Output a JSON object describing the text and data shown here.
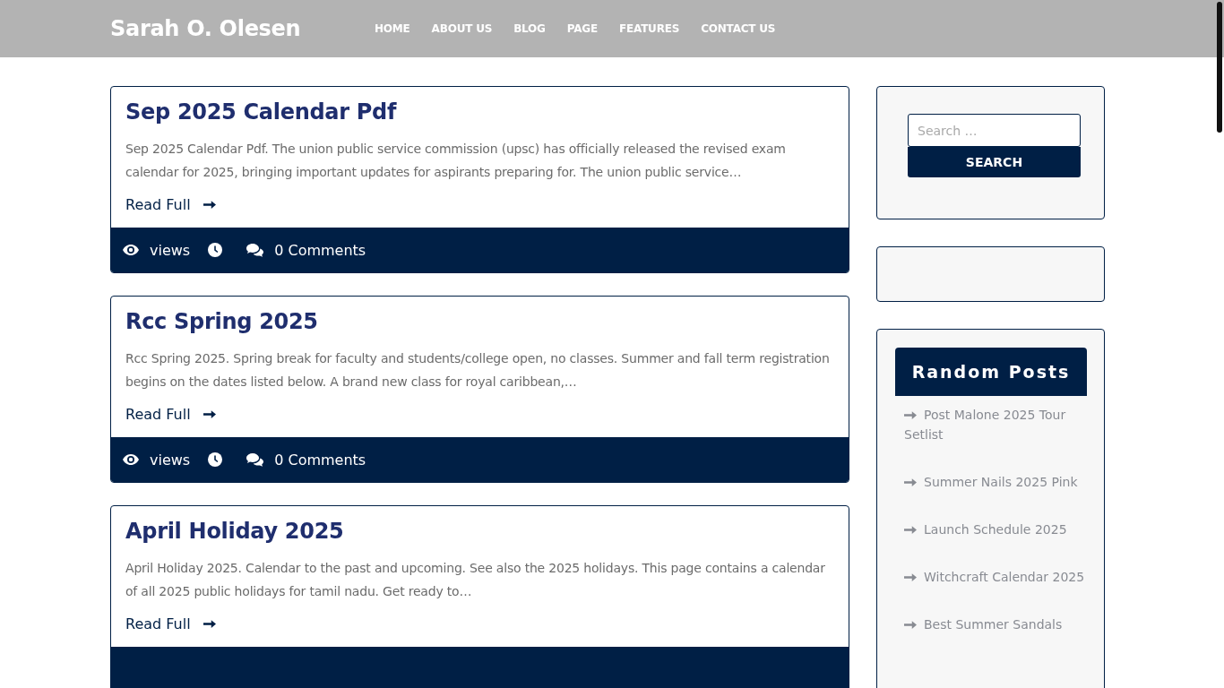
{
  "header": {
    "site_title": "Sarah O. Olesen",
    "nav": [
      {
        "label": "HOME"
      },
      {
        "label": "ABOUT US"
      },
      {
        "label": "BLOG"
      },
      {
        "label": "PAGE"
      },
      {
        "label": "FEATURES"
      },
      {
        "label": "CONTACT US"
      }
    ]
  },
  "posts": [
    {
      "title": "Sep 2025 Calendar Pdf",
      "excerpt": "Sep 2025 Calendar Pdf. The union public service commission (upsc) has officially released the revised exam calendar for 2025, bringing important updates for aspirants preparing for. The union public service…",
      "read_more": "Read Full",
      "meta": {
        "views": "views",
        "comments": "0 Comments"
      }
    },
    {
      "title": "Rcc Spring 2025",
      "excerpt": "Rcc Spring 2025. Spring break for faculty and students/college open, no classes. Summer and fall term registration begins on the dates listed below. A brand new class for royal caribbean,…",
      "read_more": "Read Full",
      "meta": {
        "views": "views",
        "comments": "0 Comments"
      }
    },
    {
      "title": "April Holiday 2025",
      "excerpt": "April Holiday 2025. Calendar to the past and upcoming. See also the 2025 holidays. This page contains a calendar of all 2025 public holidays for tamil nadu. Get ready to…",
      "read_more": "Read Full"
    }
  ],
  "sidebar": {
    "search": {
      "placeholder": "Search …",
      "button": "SEARCH"
    },
    "random_posts": {
      "title": "Random Posts",
      "items": [
        "Post Malone 2025 Tour Setlist",
        "Summer Nails 2025 Pink",
        "Launch Schedule 2025",
        "Witchcraft Calendar 2025",
        "Best Summer Sandals"
      ]
    }
  }
}
